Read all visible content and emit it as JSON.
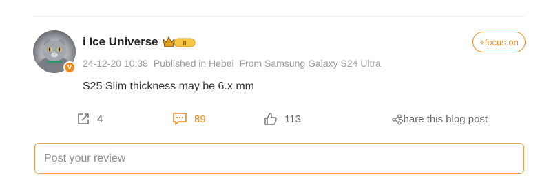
{
  "post": {
    "author": "i Ice Universe",
    "crown_badge_text": "II",
    "follow_label": "+focus on",
    "meta": {
      "timestamp": "24-12-20 10:38",
      "location": "Published in Hebei",
      "source": "From Samsung Galaxy S24 Ultra"
    },
    "text": "S25 Slim thickness may be 6.x mm",
    "verified_badge": "V"
  },
  "actions": {
    "repost_count": "4",
    "comment_count": "89",
    "like_count": "113",
    "share_label": "share this blog post"
  },
  "review": {
    "placeholder": "Post your review"
  },
  "colors": {
    "accent": "#f08a1c",
    "text": "#333333",
    "muted": "#9a9a9a"
  }
}
